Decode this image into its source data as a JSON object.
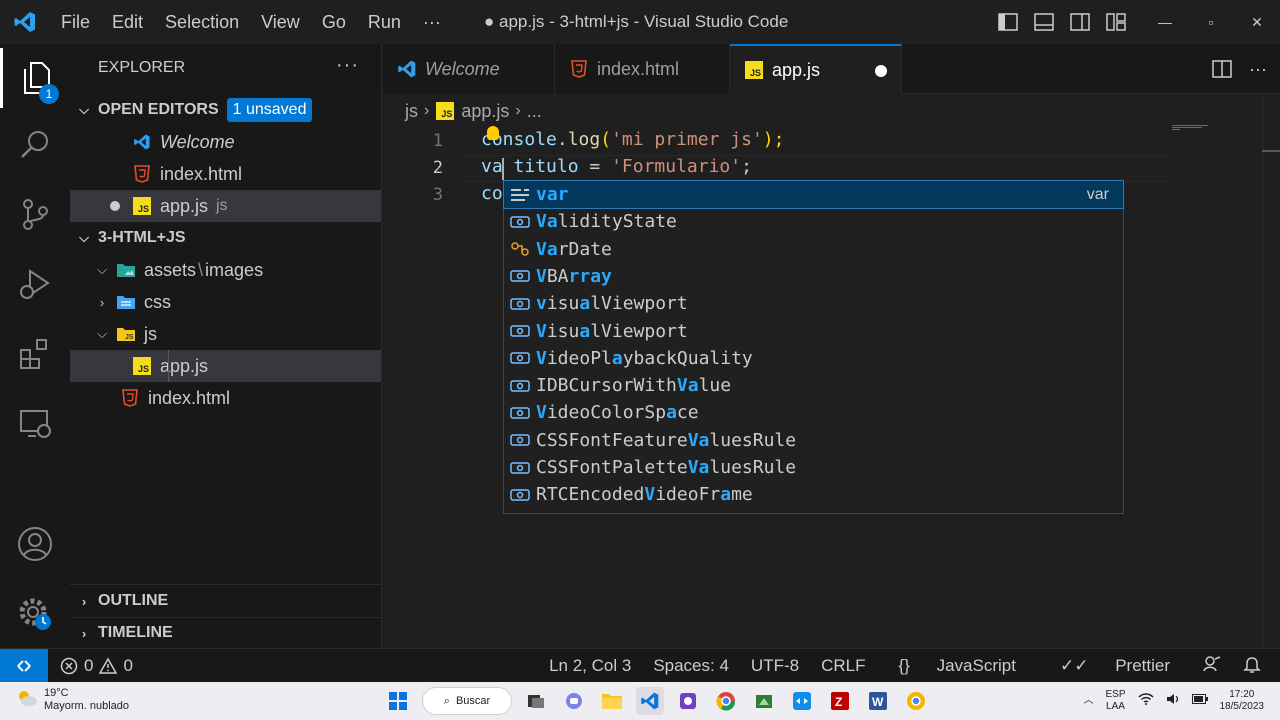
{
  "titlebar": {
    "menu": [
      "File",
      "Edit",
      "Selection",
      "View",
      "Go",
      "Run",
      "···"
    ],
    "title": "● app.js - 3-html+js - Visual Studio Code"
  },
  "activity": {
    "explorer_badge": "1"
  },
  "sidebar": {
    "title": "EXPLORER",
    "more": "···",
    "open_editors": {
      "label": "OPEN EDITORS",
      "badge": "1 unsaved",
      "items": [
        {
          "label": "Welcome"
        },
        {
          "label": "index.html"
        },
        {
          "label": "app.js",
          "folder": "js"
        }
      ]
    },
    "project": {
      "label": "3-HTML+JS",
      "items": [
        {
          "label": "assets",
          "sub": "images"
        },
        {
          "label": "css"
        },
        {
          "label": "js"
        },
        {
          "label": "app.js"
        },
        {
          "label": "index.html"
        }
      ]
    },
    "outline": "OUTLINE",
    "timeline": "TIMELINE"
  },
  "tabs": [
    {
      "label": "Welcome"
    },
    {
      "label": "index.html"
    },
    {
      "label": "app.js"
    }
  ],
  "breadcrumb": {
    "folder": "js",
    "file": "app.js",
    "more": "..."
  },
  "editor": {
    "line_numbers": [
      "1",
      "2",
      "3"
    ],
    "line1": {
      "obj": "console",
      "dot": ".",
      "fn": "log",
      "open": "(",
      "str": "'mi primer js'",
      "close": ");"
    },
    "line2": {
      "typed": "va",
      "rest_var": " titulo",
      "eq": " = ",
      "str": "'Formulario'",
      "semi": ";"
    },
    "line3": {
      "typed": "co"
    }
  },
  "suggest": {
    "items": [
      {
        "parts": [
          [
            "",
            "var"
          ]
        ],
        "kind": "keyword",
        "detail": "var"
      },
      {
        "parts": [
          [
            "Va",
            ""
          ],
          [
            "lidityState",
            ""
          ]
        ],
        "kind": "variable"
      },
      {
        "parts": [
          [
            "Va",
            ""
          ],
          [
            "r",
            ""
          ],
          [
            "Date",
            ""
          ]
        ],
        "kind": "class"
      },
      {
        "parts": [
          [
            "V",
            ""
          ],
          [
            "BA",
            ""
          ],
          [
            "rray",
            ""
          ]
        ],
        "kind": "variable"
      },
      {
        "parts": [
          [
            "v",
            ""
          ],
          [
            "isu",
            ""
          ],
          [
            "a",
            ""
          ],
          [
            "lViewport",
            ""
          ]
        ],
        "kind": "variable"
      },
      {
        "parts": [
          [
            "V",
            ""
          ],
          [
            "isu",
            ""
          ],
          [
            "a",
            ""
          ],
          [
            "lViewport",
            ""
          ]
        ],
        "kind": "variable"
      },
      {
        "parts": [
          [
            "V",
            ""
          ],
          [
            "ideoPl",
            ""
          ],
          [
            "a",
            ""
          ],
          [
            "ybackQuality",
            ""
          ]
        ],
        "kind": "variable"
      },
      {
        "parts": [
          [
            "IDBCursorWith",
            ""
          ],
          [
            "Va",
            ""
          ],
          [
            "lue",
            ""
          ]
        ],
        "kind": "variable"
      },
      {
        "parts": [
          [
            "V",
            ""
          ],
          [
            "ideoColorSp",
            ""
          ],
          [
            "a",
            ""
          ],
          [
            "ce",
            ""
          ]
        ],
        "kind": "variable"
      },
      {
        "parts": [
          [
            "CSSFontFeature",
            ""
          ],
          [
            "Va",
            ""
          ],
          [
            "luesRule",
            ""
          ]
        ],
        "kind": "variable"
      },
      {
        "parts": [
          [
            "CSSFontPalette",
            ""
          ],
          [
            "Va",
            ""
          ],
          [
            "luesRule",
            ""
          ]
        ],
        "kind": "variable"
      },
      {
        "parts": [
          [
            "RTCEncoded",
            ""
          ],
          [
            "V",
            ""
          ],
          [
            "ideoFr",
            ""
          ],
          [
            "a",
            ""
          ],
          [
            "me",
            ""
          ]
        ],
        "kind": "variable"
      }
    ],
    "rendered": [
      {
        "pre": "",
        "hl": "var",
        "post": "",
        "detail": "var"
      },
      {
        "segs": [
          "",
          "Va",
          "lidityState"
        ]
      },
      {
        "segs": [
          "",
          "Va",
          "rDate"
        ]
      },
      {
        "segs": [
          "",
          "V",
          "BA",
          "rray"
        ]
      },
      {
        "segs": [
          "",
          "v",
          "isu",
          "a",
          "lViewport"
        ]
      },
      {
        "segs": [
          "",
          "V",
          "isu",
          "a",
          "lViewport"
        ]
      },
      {
        "segs": [
          "",
          "V",
          "ideoPl",
          "a",
          "ybackQuality"
        ]
      },
      {
        "segs": [
          "IDBCursorWith",
          "Va",
          "lue"
        ]
      },
      {
        "segs": [
          "",
          "V",
          "ideoColorSp",
          "a",
          "ce"
        ]
      },
      {
        "segs": [
          "CSSFontFeature",
          "Va",
          "luesRule"
        ]
      },
      {
        "segs": [
          "CSSFontPalette",
          "Va",
          "luesRule"
        ]
      },
      {
        "segs": [
          "RTCEncoded",
          "V",
          "ideoFr",
          "a",
          "me"
        ]
      }
    ]
  },
  "statusbar": {
    "errors": "0",
    "warnings": "0",
    "position": "Ln 2, Col 3",
    "spaces": "Spaces: 4",
    "encoding": "UTF-8",
    "eol": "CRLF",
    "language": "JavaScript",
    "prettier": "Prettier"
  },
  "taskbar": {
    "temp": "19°C",
    "weather": "Mayorm. nublado",
    "search": "Buscar",
    "lang1": "ESP",
    "lang2": "LAA",
    "time": "17:20",
    "date": "18/5/2023"
  },
  "colors": {
    "accent": "#0078d4",
    "keyword": "#569cd6",
    "string": "#ce9178",
    "function": "#dcdcaa",
    "variable": "#9cdcfe",
    "match": "#2aaaff"
  }
}
